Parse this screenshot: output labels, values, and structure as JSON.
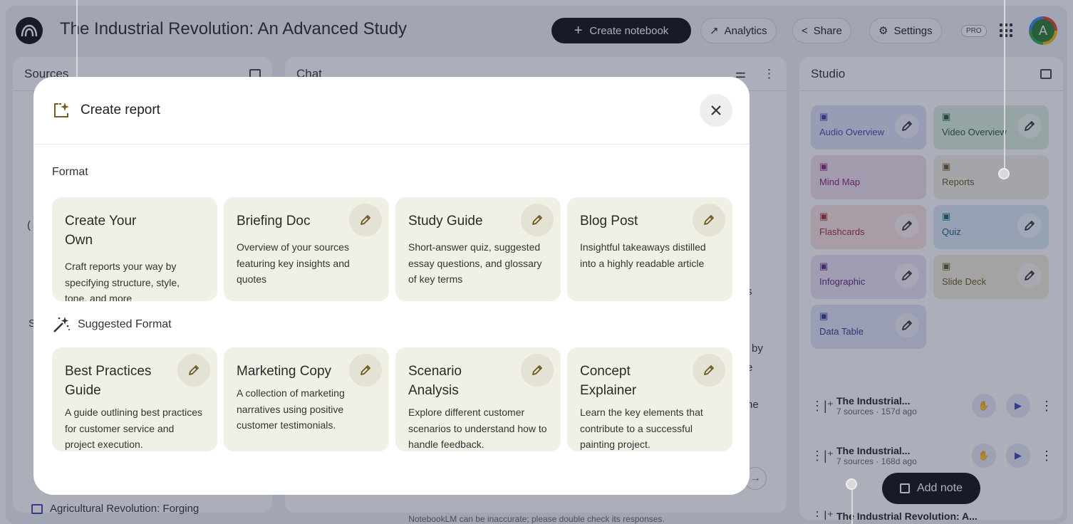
{
  "app": {
    "notebook_title": "The Industrial Revolution: An Advanced Study",
    "create_notebook_label": "Create notebook",
    "analytics_label": "Analytics",
    "share_label": "Share",
    "settings_label": "Settings",
    "pro_badge": "PRO",
    "avatar_initial": "A",
    "disclaimer": "NotebookLM can be inaccurate; please double check its responses."
  },
  "sources_panel": {
    "title": "Sources",
    "visible_fragment_letter_1": "(",
    "visible_fragment_letter_2": "S",
    "partial_source_title": "Agricultural Revolution: Forging"
  },
  "chat_panel": {
    "title": "Chat",
    "fragments": [
      "s",
      "by",
      "e",
      "he"
    ]
  },
  "studio_panel": {
    "title": "Studio",
    "tiles": [
      {
        "label": "Audio Overview",
        "icon": "audio-wave-icon",
        "bg": "#dfe3f7",
        "color": "#3c4aa8",
        "editable": true
      },
      {
        "label": "Video Overview",
        "icon": "video-icon",
        "bg": "#dcefdf",
        "color": "#1f5e2c",
        "editable": true
      },
      {
        "label": "Mind Map",
        "icon": "mind-map-icon",
        "bg": "#efe0ee",
        "color": "#8a2680",
        "editable": false
      },
      {
        "label": "Reports",
        "icon": "reports-icon",
        "bg": "#f1f0e4",
        "color": "#6b5a1f",
        "editable": false
      },
      {
        "label": "Flashcards",
        "icon": "flashcards-icon",
        "bg": "#f8e3e3",
        "color": "#a3302f",
        "editable": true
      },
      {
        "label": "Quiz",
        "icon": "quiz-icon",
        "bg": "#dcecf6",
        "color": "#1d5f86",
        "editable": true
      },
      {
        "label": "Infographic",
        "icon": "infographic-icon",
        "bg": "#ece3f2",
        "color": "#5b2a86",
        "editable": true
      },
      {
        "label": "Slide Deck",
        "icon": "slide-deck-icon",
        "bg": "#f1eede",
        "color": "#6b5a1f",
        "editable": true
      },
      {
        "label": "Data Table",
        "icon": "data-table-icon",
        "bg": "#e0e5f7",
        "color": "#2f3f8f",
        "editable": true
      }
    ],
    "notes": [
      {
        "title": "The Industrial...",
        "meta": "7 sources · 157d ago"
      },
      {
        "title": "The Industrial...",
        "meta": "7 sources · 168d ago"
      },
      {
        "title": "The Industrial Revolution: A...",
        "meta": ""
      }
    ],
    "add_note_label": "Add note"
  },
  "dialog": {
    "title": "Create report",
    "format_label": "Format",
    "suggested_label": "Suggested Format",
    "formats": [
      {
        "title": "Create Your Own",
        "description": "Craft reports your way by specifying structure, style, tone, and more",
        "editable": false
      },
      {
        "title": "Briefing Doc",
        "description": "Overview of your sources featuring key insights and quotes",
        "editable": true
      },
      {
        "title": "Study Guide",
        "description": "Short-answer quiz, suggested essay questions, and glossary of key terms",
        "editable": true
      },
      {
        "title": "Blog Post",
        "description": "Insightful takeaways distilled into a highly readable article",
        "editable": true
      }
    ],
    "suggested": [
      {
        "title": "Best Practices Guide",
        "description": "A guide outlining best practices for customer service and project execution.",
        "editable": true
      },
      {
        "title": "Marketing Copy",
        "description": "A collection of marketing narratives using positive customer testimonials.",
        "editable": true
      },
      {
        "title": "Scenario Analysis",
        "description": "Explore different customer scenarios to understand how to handle feedback.",
        "editable": true
      },
      {
        "title": "Concept Explainer",
        "description": "Learn the key elements that contribute to a successful painting project.",
        "editable": true
      }
    ]
  }
}
